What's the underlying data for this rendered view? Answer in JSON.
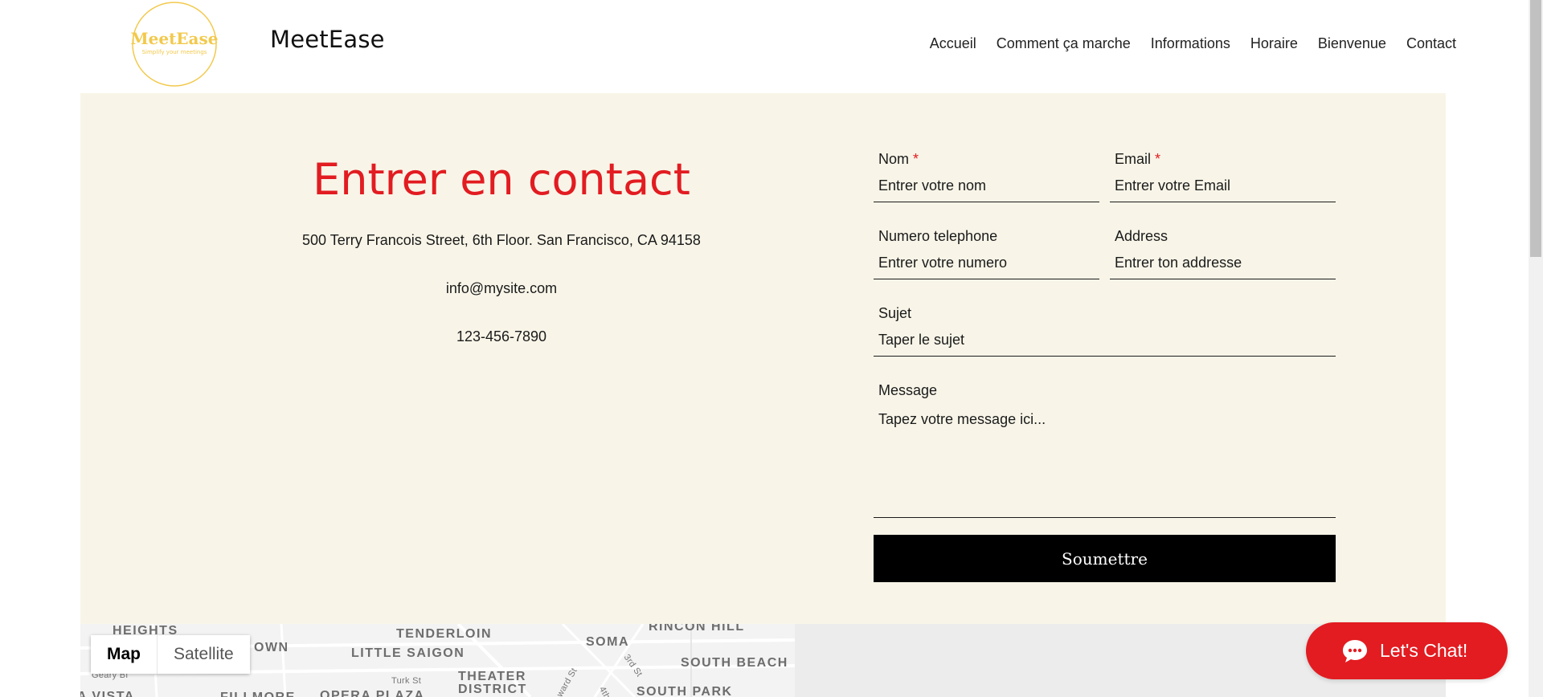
{
  "header": {
    "logo_text": "MeetEase",
    "logo_tagline": "Simplify your meetings",
    "site_name": "MeetEase",
    "nav": [
      "Accueil",
      "Comment ça marche",
      "Informations",
      "Horaire",
      "Bienvenue",
      "Contact"
    ]
  },
  "contact": {
    "title": "Entrer en contact",
    "address": "500 Terry Francois Street, 6th Floor. San Francisco, CA 94158",
    "email": "info@mysite.com",
    "phone": "123-456-7890"
  },
  "form": {
    "name": {
      "label": "Nom",
      "required_mark": "*",
      "placeholder": "Entrer votre nom"
    },
    "email": {
      "label": "Email",
      "required_mark": "*",
      "placeholder": "Entrer votre Email"
    },
    "phone": {
      "label": "Numero telephone",
      "placeholder": "Entrer votre numero"
    },
    "address": {
      "label": "Address",
      "placeholder": "Entrer ton addresse"
    },
    "subject": {
      "label": "Sujet",
      "placeholder": "Taper le sujet"
    },
    "message": {
      "label": "Message",
      "placeholder": "Tapez votre message ici..."
    },
    "submit_label": "Soumettre"
  },
  "map": {
    "toggle": [
      "Map",
      "Satellite"
    ],
    "labels": [
      "HEIGHTS",
      "TENDERLOIN",
      "RINCON HILL",
      "OWN",
      "LITTLE SAIGON",
      "SOMA",
      "SOUTH BEACH",
      "THEATER",
      "DISTRICT",
      "SOUTH PARK",
      "A VISTA",
      "FILLMORE",
      "OPERA PLAZA"
    ],
    "small_labels": [
      "Geary Bl",
      "Turk St",
      "3rd St",
      "ward St",
      "4th"
    ]
  },
  "chat": {
    "label": "Let's Chat!"
  },
  "colors": {
    "accent": "#e21c21",
    "section_bg": "#f8f5e8",
    "logo_gold": "#f2c94c"
  }
}
